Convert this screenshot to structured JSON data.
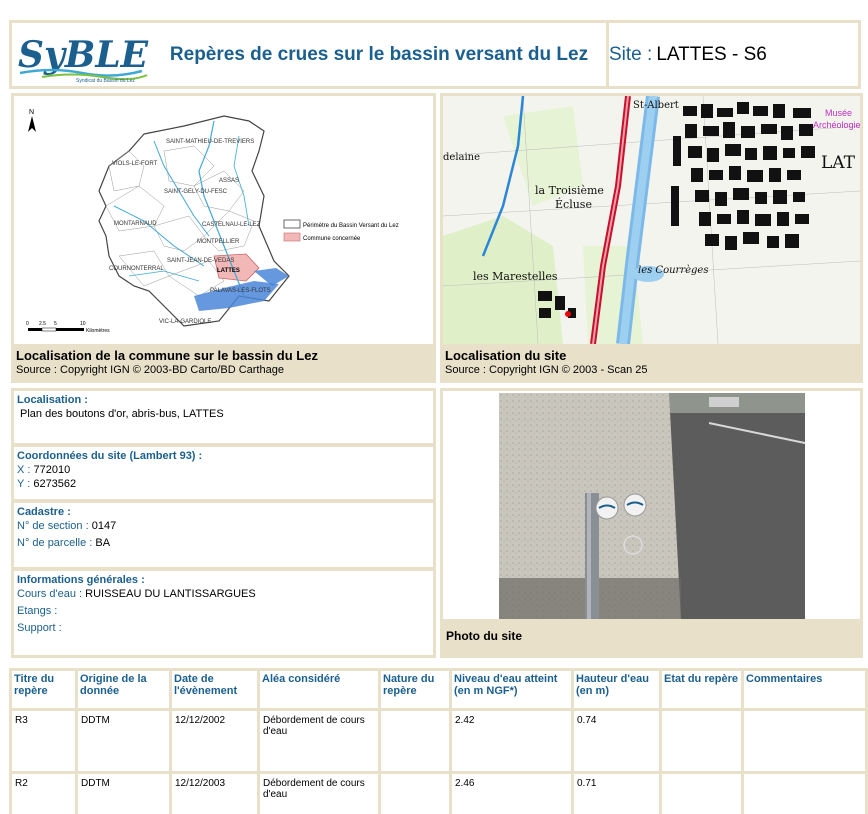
{
  "header": {
    "logo_text": "SyBLE",
    "logo_subtitle": "Syndicat du Bassin du Lez",
    "title": "Repères de crues sur le bassin versant du Lez",
    "site_label": "Site :",
    "site_value": "LATTES - S6"
  },
  "basin_map": {
    "north": "N",
    "towns": [
      "SAINT-MATHIEU-DE-TREVIERS",
      "VIOLS-LE-FORT",
      "SAINT-GELY-DU-FESC",
      "ASSAS",
      "MONTARNAUD",
      "CASTELNAU-LE-LEZ",
      "MONTPELLIER",
      "COURNONTERRAL",
      "SAINT-JEAN-DE-VEDAS",
      "LATTES",
      "PALAVAS-LES-FLOTS",
      "VIC-LA-GARDIOLE"
    ],
    "legend": [
      "Périmètre du Bassin Versant du Lez",
      "Commune concernée"
    ],
    "scale_labels": [
      "0",
      "2.5",
      "5",
      "10"
    ],
    "scale_unit": "Kilomètres",
    "caption_title": "Localisation de la commune sur le bassin du Lez",
    "caption_source": "Source : Copyright IGN © 2003-BD Carto/BD Carthage"
  },
  "site_map": {
    "labels": [
      "St-Albert",
      "la Troisième",
      "Écluse",
      "les Marestelles",
      "les Courrèges",
      "LAT",
      "Musée",
      "Archéologie",
      "delaine"
    ],
    "caption_title": "Localisation du site",
    "caption_source": "Source : Copyright IGN © 2003 - Scan 25"
  },
  "info": {
    "localisation_h": "Localisation :",
    "localisation_v": "Plan des boutons d'or, abris-bus, LATTES",
    "coord_h": "Coordonnées du site (Lambert 93) :",
    "x_k": "X :",
    "x_v": "772010",
    "y_k": "Y :",
    "y_v": "6273562",
    "cadastre_h": "Cadastre :",
    "section_k": "N° de section :",
    "section_v": "0147",
    "parcelle_k": "N° de parcelle :",
    "parcelle_v": "BA",
    "gen_h": "Informations générales :",
    "cours_k": "Cours d'eau :",
    "cours_v": "RUISSEAU DU LANTISSARGUES",
    "etangs_k": "Etangs :",
    "support_k": "Support :"
  },
  "photo": {
    "caption": "Photo du site"
  },
  "table": {
    "headers": [
      "Titre du repère",
      "Origine de la donnée",
      "Date de l'évènement",
      "Aléa considéré",
      "Nature du repère",
      "Niveau d'eau atteint (en m NGF*)",
      "Hauteur d'eau (en m)",
      "Etat du repère",
      "Commentaires"
    ],
    "rows": [
      [
        "R3",
        "DDTM",
        "12/12/2002",
        "Débordement de cours d'eau",
        "",
        "2.42",
        "0.74",
        "",
        ""
      ],
      [
        "R2",
        "DDTM",
        "12/12/2003",
        "Débordement de cours d'eau",
        "",
        "2.46",
        "0.71",
        "",
        ""
      ]
    ]
  }
}
